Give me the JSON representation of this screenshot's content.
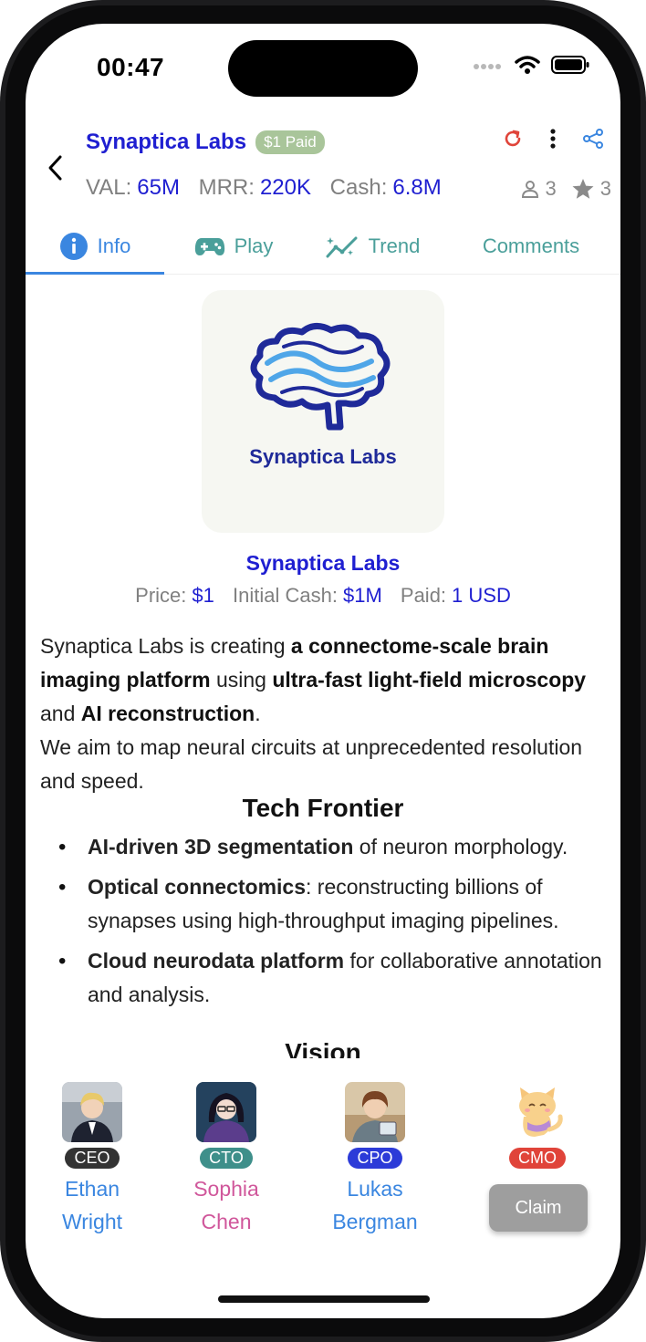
{
  "status_bar": {
    "time": "00:47"
  },
  "header": {
    "title": "Synaptica Labs",
    "paid_badge": "$1 Paid",
    "metrics": [
      {
        "label": "VAL:",
        "value": "65M"
      },
      {
        "label": "MRR:",
        "value": "220K"
      },
      {
        "label": "Cash:",
        "value": "6.8M"
      }
    ],
    "members_count": "3",
    "stars_count": "3",
    "icons": [
      "back-chevron-icon",
      "refresh-icon",
      "more-vertical-icon",
      "share-icon",
      "person-icon",
      "star-icon"
    ]
  },
  "tabs": [
    {
      "label": "Info",
      "icon": "info-icon",
      "active": true
    },
    {
      "label": "Play",
      "icon": "gamepad-icon",
      "active": false
    },
    {
      "label": "Trend",
      "icon": "trend-icon",
      "active": false
    },
    {
      "label": "Comments",
      "icon": "",
      "active": false
    }
  ],
  "info": {
    "logo_text": "Synaptica Labs",
    "company_name": "Synaptica Labs",
    "price_label": "Price:",
    "price_value": "$1",
    "initial_cash_label": "Initial Cash:",
    "initial_cash_value": "$1M",
    "paid_label": "Paid:",
    "paid_value": "1 USD",
    "desc": {
      "p1a": "Synaptica Labs is creating ",
      "p1b": "a connectome-scale brain imaging platform",
      "p1c": " using ",
      "p1d": "ultra-fast light-field microscopy",
      "p1e": " and ",
      "p1f": "AI reconstruction",
      "p1g": ".",
      "p2": "We aim to map neural circuits at unprecedented resolution and speed."
    },
    "tech_heading": "Tech Frontier",
    "bullets": [
      {
        "bold": "AI-driven 3D segmentation",
        "rest": " of neuron morphology."
      },
      {
        "bold": "Optical connectomics",
        "rest": ": reconstructing billions of synapses using high-throughput imaging pipelines."
      },
      {
        "bold": "Cloud neurodata platform",
        "rest": " for collaborative annotation and analysis."
      }
    ],
    "vision_heading": "Vision"
  },
  "team": [
    {
      "role": "CEO",
      "first": "Ethan",
      "last": "Wright",
      "role_color": "#333333",
      "name_color": "#3a86e0"
    },
    {
      "role": "CTO",
      "first": "Sophia",
      "last": "Chen",
      "role_color": "#3e8f8a",
      "name_color": "#d0579b"
    },
    {
      "role": "CPO",
      "first": "Lukas",
      "last": "Bergman",
      "role_color": "#2c3bd8",
      "name_color": "#3a86e0"
    },
    {
      "role": "CMO",
      "first": "",
      "last": "",
      "role_color": "#e0443a",
      "name_color": "#3a86e0"
    }
  ],
  "claim_label": "Claim"
}
